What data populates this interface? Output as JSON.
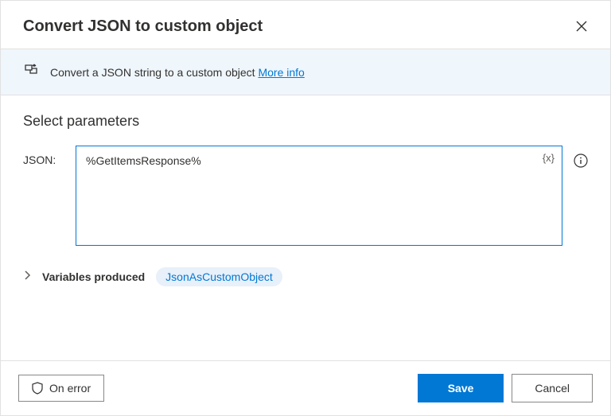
{
  "dialog": {
    "title": "Convert JSON to custom object"
  },
  "banner": {
    "description": "Convert a JSON string to a custom object ",
    "link_text": "More info"
  },
  "section": {
    "title": "Select parameters",
    "json_label": "JSON:",
    "json_value": "%GetItemsResponse%",
    "var_insert_label": "{x}"
  },
  "variables": {
    "label": "Variables produced",
    "chip": "JsonAsCustomObject"
  },
  "footer": {
    "on_error": "On error",
    "save": "Save",
    "cancel": "Cancel"
  }
}
